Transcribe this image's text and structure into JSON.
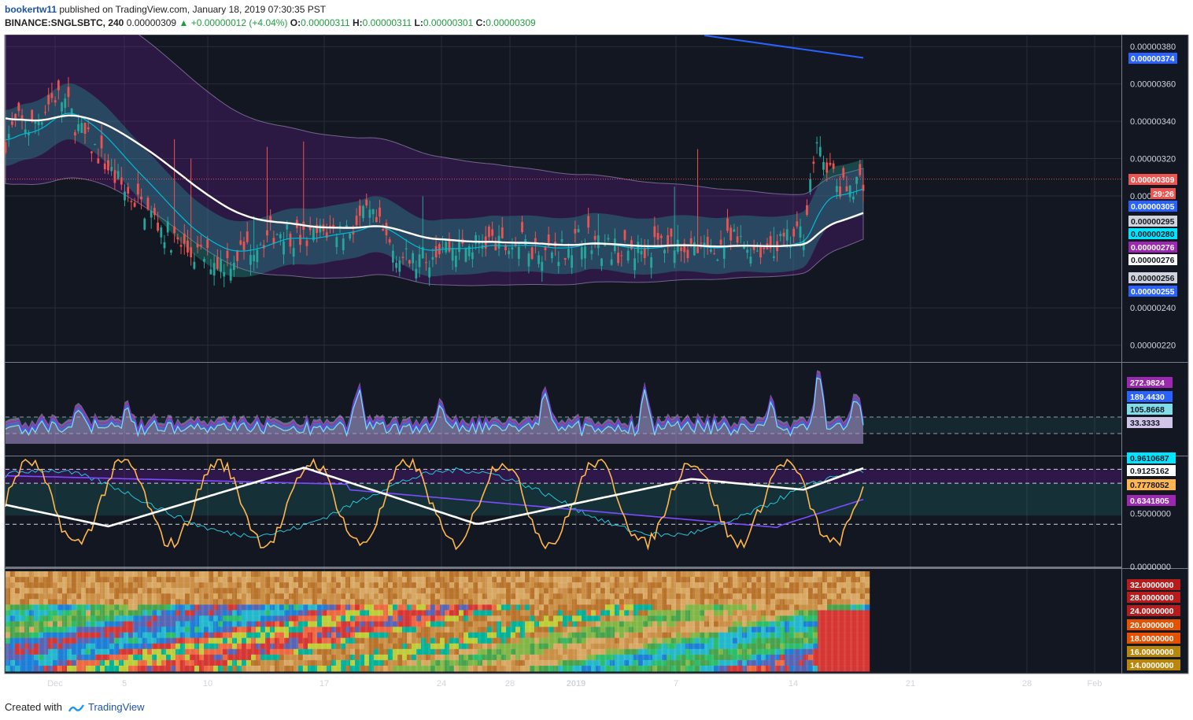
{
  "header": {
    "author": "bookertw11",
    "published_text": "published on TradingView.com, January 18, 2019 07:30:35 PST",
    "symbol": "BINANCE:SNGLSBTC, 240",
    "last_price": "0.00000309",
    "change": "+0.00000012 (+4.04%)",
    "open_label": "O:",
    "open": "0.00000311",
    "high_label": "H:",
    "high": "0.00000311",
    "low_label": "L:",
    "low": "0.00000301",
    "close_label": "C:",
    "close": "0.00000309"
  },
  "colors": {
    "background": "#131722",
    "grid": "#2a2e39",
    "up": "#26a69a",
    "down": "#ef5350",
    "ma_white": "#ffffff",
    "ma_cyan": "#00bcd4",
    "trendline": "#2962ff",
    "price_line": "#ef5350",
    "purple": "#8e24aa",
    "orange": "#ffb74d"
  },
  "chart_data": [
    {
      "type": "candlestick",
      "panel": "price",
      "ylim": [
        2.11e-06,
        3.86e-06
      ],
      "y_ticks": [
        "0.00000380",
        "0.00000360",
        "0.00000340",
        "0.00000320",
        "0.00000300",
        "0.00000240",
        "0.00000220"
      ],
      "x_ticks": [
        "Dec",
        "5",
        "10",
        "17",
        "24",
        "28",
        "2019",
        "7",
        "14",
        "21",
        "28",
        "Feb"
      ],
      "price_labels": [
        {
          "text": "0.00000374",
          "bg": "#2962ff",
          "fg": "#ffffff"
        },
        {
          "text": "0.00000309",
          "bg": "#ef5350",
          "fg": "#ffffff"
        },
        {
          "text": "29:26",
          "bg": "#ef5350",
          "fg": "#ffffff"
        },
        {
          "text": "0.00000305",
          "bg": "#2962ff",
          "fg": "#ffffff"
        },
        {
          "text": "0.00000295",
          "bg": "#d1d4dc",
          "fg": "#131722"
        },
        {
          "text": "0.00000280",
          "bg": "#00e5ff",
          "fg": "#131722"
        },
        {
          "text": "0.00000276",
          "bg": "#9c27b0",
          "fg": "#ffffff"
        },
        {
          "text": "0.00000276",
          "bg": "#ffffff",
          "fg": "#131722"
        },
        {
          "text": "0.00000256",
          "bg": "#d1d4dc",
          "fg": "#131722"
        },
        {
          "text": "0.00000255",
          "bg": "#2962ff",
          "fg": "#ffffff"
        }
      ],
      "close_series": [
        3.3,
        3.4,
        3.36,
        3.44,
        3.54,
        3.5,
        3.36,
        3.28,
        3.2,
        3.1,
        3.02,
        2.96,
        2.9,
        2.82,
        2.76,
        2.7,
        2.68,
        2.66,
        2.64,
        2.68,
        2.72,
        2.76,
        2.8,
        2.82,
        2.78,
        2.76,
        2.8,
        2.82,
        2.82,
        2.84,
        2.9,
        2.82,
        2.72,
        2.66,
        2.64,
        2.68,
        2.74,
        2.72,
        2.72,
        2.74,
        2.76,
        2.72,
        2.74,
        2.74,
        2.72,
        2.7,
        2.72,
        2.74,
        2.8,
        2.74,
        2.72,
        2.7,
        2.7,
        2.72,
        2.74,
        2.76,
        2.74,
        2.72,
        2.7,
        2.72,
        2.76,
        2.74,
        2.72,
        2.72,
        2.74,
        2.76,
        2.8,
        3.24,
        3.18,
        3.02,
        3.06,
        3.09
      ]
    },
    {
      "type": "area",
      "panel": "oscillator_1",
      "series": [
        {
          "name": "",
          "last": "272.9824",
          "color": "#9c27b0"
        },
        {
          "name": "",
          "last": "189.4430",
          "color": "#2962ff"
        },
        {
          "name": "",
          "last": "105.8668",
          "color": "#80deea"
        },
        {
          "name": "",
          "last": "33.3333",
          "color": "#d1c4e9"
        }
      ]
    },
    {
      "type": "line",
      "panel": "oscillator_2",
      "ylim": [
        0,
        1
      ],
      "y_ticks": [
        "0.5000000",
        "0.0000000"
      ],
      "series": [
        {
          "name": "",
          "last": "0.9610687",
          "color": "#00e5ff"
        },
        {
          "name": "",
          "last": "0.9125162",
          "color": "#ffffff"
        },
        {
          "name": "",
          "last": "0.7778052",
          "color": "#ffb74d"
        },
        {
          "name": "",
          "last": "0.6341805",
          "color": "#9c27b0"
        }
      ]
    },
    {
      "type": "heatmap",
      "panel": "heatmap",
      "y_ticks": [
        "32.0000000",
        "28.0000000",
        "24.0000000",
        "20.0000000",
        "18.0000000",
        "16.0000000",
        "14.0000000"
      ],
      "y_tick_colors": [
        "#b71c1c",
        "#b71c1c",
        "#b71c1c",
        "#e65100",
        "#e65100",
        "#b8860b",
        "#b8860b"
      ]
    }
  ],
  "footer": {
    "created_with": "Created with",
    "brand": "TradingView"
  }
}
